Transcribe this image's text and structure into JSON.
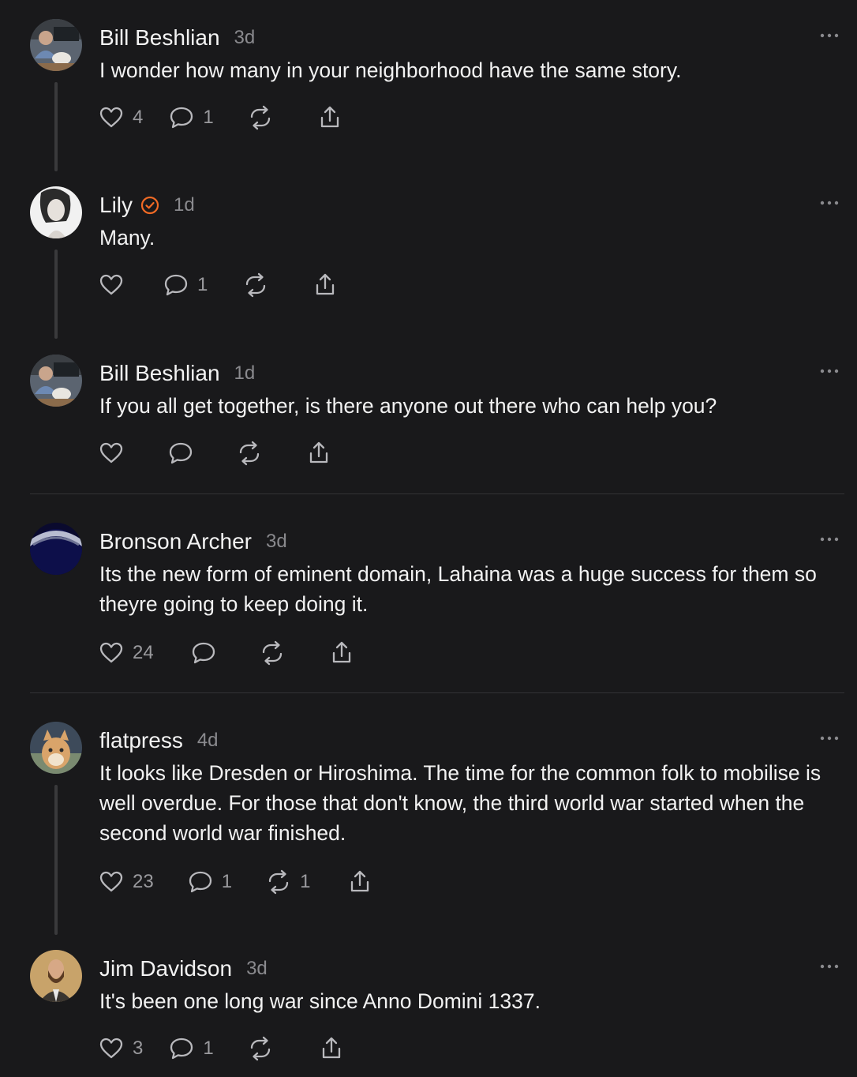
{
  "posts": [
    {
      "name": "Bill Beshlian",
      "time": "3d",
      "verified": false,
      "text": "I wonder how many in your neighborhood have the same story.",
      "likes": "4",
      "replies": "1",
      "reposts": ""
    },
    {
      "name": "Lily",
      "time": "1d",
      "verified": true,
      "text": "Many.",
      "likes": "",
      "replies": "1",
      "reposts": ""
    },
    {
      "name": "Bill Beshlian",
      "time": "1d",
      "verified": false,
      "text": "If you all get together, is there anyone out there who can help you?",
      "likes": "",
      "replies": "",
      "reposts": ""
    },
    {
      "name": "Bronson Archer",
      "time": "3d",
      "verified": false,
      "text": "Its the new form of eminent domain, Lahaina was a huge success for them so theyre going to keep doing it.",
      "likes": "24",
      "replies": "",
      "reposts": ""
    },
    {
      "name": "flatpress",
      "time": "4d",
      "verified": false,
      "text": "It looks like Dresden or Hiroshima. The time for the common folk to mobilise is well overdue. For those that don't know, the third world war started when the second world war finished.",
      "likes": "23",
      "replies": "1",
      "reposts": "1"
    },
    {
      "name": "Jim Davidson",
      "time": "3d",
      "verified": false,
      "text": "It's been one long war since Anno Domini 1337.",
      "likes": "3",
      "replies": "1",
      "reposts": ""
    }
  ],
  "icons": {
    "like": "heart-icon",
    "reply": "comment-bubble-icon",
    "repost": "repost-icon",
    "share": "share-icon",
    "more": "more-options-icon",
    "verified": "verified-badge-icon"
  },
  "colors": {
    "background": "#19191b",
    "text": "#f2f2f2",
    "muted": "#8a8a8e",
    "verified": "#f06a25"
  }
}
